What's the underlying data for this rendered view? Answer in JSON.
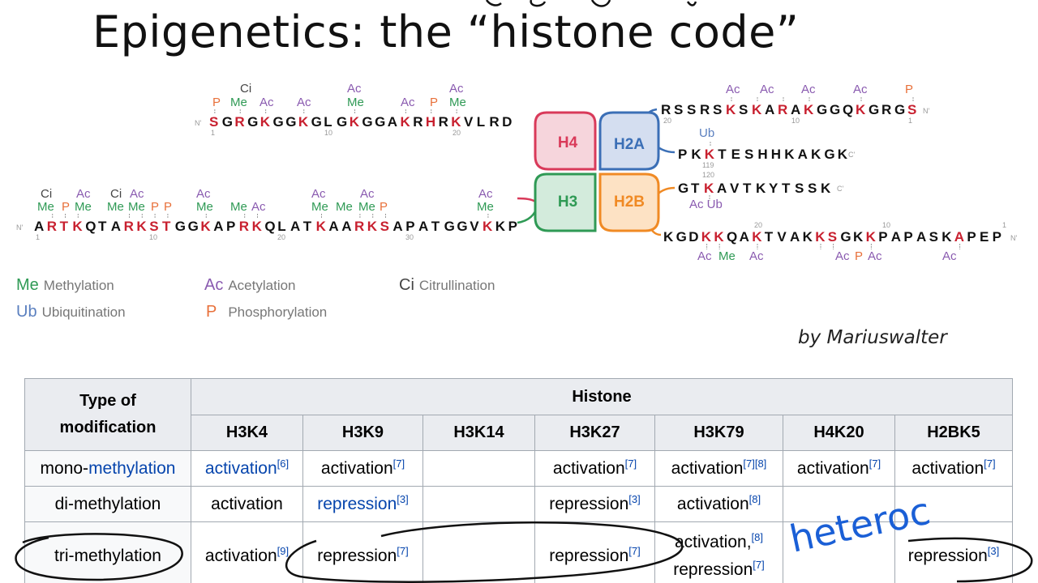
{
  "slide": {
    "title": "Epigenetics: the “histone code”",
    "credit": "by Mariuswalter"
  },
  "diagram": {
    "h4_tail": {
      "residues": [
        "S",
        "G",
        "R",
        "G",
        "K",
        "G",
        "G",
        "K",
        "G",
        "L",
        "G",
        "K",
        "G",
        "G",
        "A",
        "K",
        "R",
        "H",
        "R",
        "K",
        "V",
        "L",
        "R",
        "D"
      ],
      "modified": [
        0,
        2,
        4,
        7,
        11,
        15,
        17,
        19
      ],
      "n_terminus": "N",
      "numbers": [
        "1",
        "10",
        "20"
      ],
      "marks": {
        "ci": "Ci",
        "p": "P",
        "me": "Me",
        "ac": "Ac"
      }
    },
    "h3_tail": {
      "residues": [
        "A",
        "R",
        "T",
        "K",
        "Q",
        "T",
        "A",
        "R",
        "K",
        "S",
        "T",
        "G",
        "G",
        "K",
        "A",
        "P",
        "R",
        "K",
        "Q",
        "L",
        "A",
        "T",
        "K",
        "A",
        "A",
        "R",
        "K",
        "S",
        "A",
        "P",
        "A",
        "T",
        "G",
        "G",
        "V",
        "K",
        "K",
        "P"
      ],
      "modified": [
        1,
        2,
        3,
        7,
        8,
        9,
        10,
        13,
        16,
        17,
        22,
        25,
        26,
        27,
        35
      ],
      "n_terminus": "N",
      "numbers": [
        "1",
        "10",
        "20",
        "30"
      ]
    },
    "h2a_n_tail": {
      "text": "RSSRSKSKARAKGGQKGRGS",
      "modified": [
        5,
        7,
        9,
        11,
        15,
        19
      ],
      "terminus": "N",
      "numbers": [
        "20",
        "10",
        "1"
      ]
    },
    "h2a_c_tail": {
      "text": "PKKTESHHKAKGK",
      "modified": [
        2
      ],
      "terminus": "C",
      "mark": "Ub",
      "number": "119"
    },
    "h2b_c_tail": {
      "text": "GTKAVTKYTSSK",
      "modified": [
        2
      ],
      "terminus": "C",
      "marks": "Ac Ub",
      "number": "120"
    },
    "h2b_n_tail": {
      "text": "KGDKKQAKTVAKKSGKKPAPASKAPEP",
      "modified": [
        3,
        4,
        7,
        12,
        13,
        16,
        23
      ],
      "terminus": "N",
      "numbers": [
        "20",
        "10",
        "1"
      ],
      "marks_below": [
        "Ac",
        "Me",
        "Ac",
        "Ac",
        "P",
        "Ac",
        "Ac"
      ]
    },
    "histones": {
      "h4": "H4",
      "h2a": "H2A",
      "h3": "H3",
      "h2b": "H2B",
      "colors": {
        "h4": "#d93a5a",
        "h2a": "#3b6fb6",
        "h3": "#2f9a55",
        "h2b": "#f08a24"
      }
    },
    "mark_colors": {
      "me": "#2f9a55",
      "ac": "#8a5bb0",
      "ci": "#444444",
      "ub": "#5a7fbf",
      "p": "#e8703a",
      "residue_mod": "#c8202f"
    }
  },
  "legend": {
    "methylation": {
      "abbr": "Me",
      "label": "Methylation"
    },
    "acetylation": {
      "abbr": "Ac",
      "label": "Acetylation"
    },
    "citrullination": {
      "abbr": "Ci",
      "label": "Citrullination"
    },
    "ubiquitination": {
      "abbr": "Ub",
      "label": "Ubiquitination"
    },
    "phosphorylation": {
      "abbr": "P",
      "label": "Phosphorylation"
    }
  },
  "table": {
    "header_type": "Type of modification",
    "header_type_line1": "Type of",
    "header_type_line2": "modification",
    "header_histone": "Histone",
    "columns": [
      "H3K4",
      "H3K9",
      "H3K14",
      "H3K27",
      "H3K79",
      "H4K20",
      "H2BK5"
    ],
    "rows": [
      {
        "type_prefix": "mono-",
        "type_link": "methylation",
        "cells": [
          {
            "text": "activation",
            "link": true,
            "ref": "[6]"
          },
          {
            "text": "activation",
            "ref": "[7]"
          },
          {
            "text": ""
          },
          {
            "text": "activation",
            "ref": "[7]"
          },
          {
            "text": "activation",
            "ref": "[7][8]"
          },
          {
            "text": "activation",
            "ref": "[7]"
          },
          {
            "text": "activation",
            "ref": "[7]"
          }
        ]
      },
      {
        "type": "di-methylation",
        "cells": [
          {
            "text": "activation"
          },
          {
            "text": "repression",
            "link": true,
            "ref": "[3]"
          },
          {
            "text": ""
          },
          {
            "text": "repression",
            "ref": "[3]"
          },
          {
            "text": "activation",
            "ref": "[8]"
          },
          {
            "text": ""
          },
          {
            "text": ""
          }
        ]
      },
      {
        "type": "tri-methylation",
        "cells": [
          {
            "text": "activation",
            "ref": "[9]"
          },
          {
            "text": "repression",
            "ref": "[7]"
          },
          {
            "text": ""
          },
          {
            "text": "repression",
            "ref": "[7]"
          },
          {
            "text": "activation,",
            "ref": "[8]",
            "text2": "repression",
            "ref2": "[7]"
          },
          {
            "text": ""
          },
          {
            "text": "repression",
            "ref": "[3]"
          }
        ]
      }
    ]
  },
  "annotations": {
    "handwriting": "heteroc",
    "ink_color": "#1a5fd6",
    "circle_color": "#111111"
  }
}
